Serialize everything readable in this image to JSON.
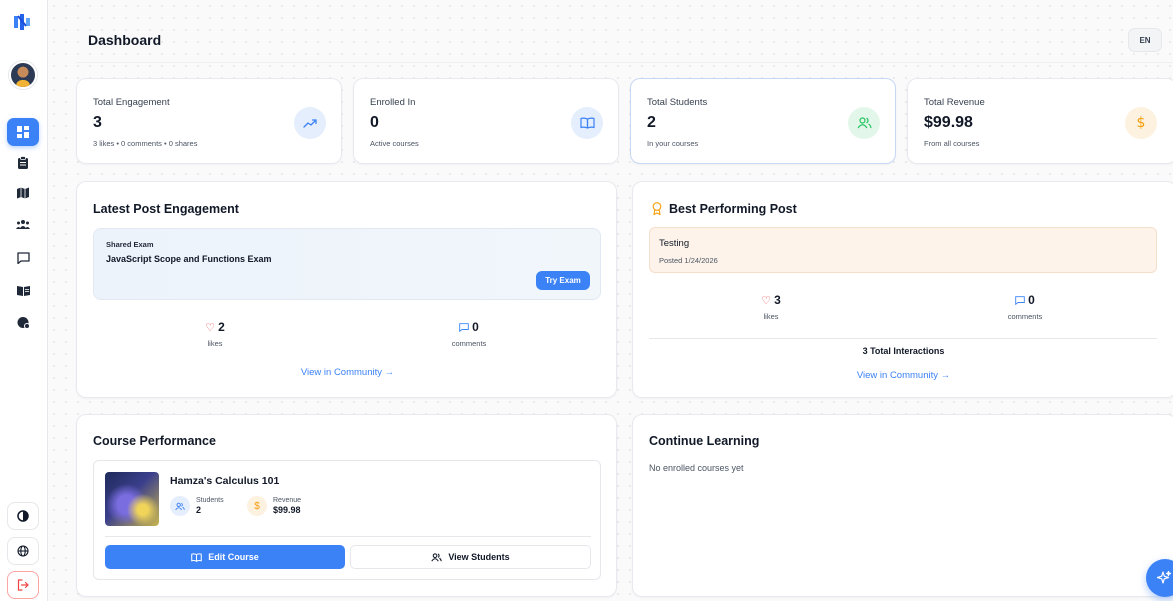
{
  "header": {
    "title": "Dashboard",
    "language": "EN"
  },
  "sidebar": {
    "items": [
      {
        "name": "dashboard",
        "icon": "dashboard-icon",
        "active": true
      },
      {
        "name": "clipboard",
        "icon": "clipboard-icon",
        "active": false
      },
      {
        "name": "map",
        "icon": "map-icon",
        "active": false
      },
      {
        "name": "community",
        "icon": "users-icon",
        "active": false
      },
      {
        "name": "messages",
        "icon": "message-icon",
        "active": false
      },
      {
        "name": "library",
        "icon": "book-open-icon",
        "active": false
      },
      {
        "name": "shield",
        "icon": "shield-icon",
        "active": false
      }
    ],
    "bottom": [
      "theme-icon",
      "globe-icon",
      "logout-icon"
    ]
  },
  "stats": [
    {
      "label": "Total Engagement",
      "value": "3",
      "sub": "3 likes • 0 comments • 0 shares",
      "icon": "trending-up-icon",
      "color": "#3b82f6"
    },
    {
      "label": "Enrolled In",
      "value": "0",
      "sub": "Active courses",
      "icon": "book-open-icon",
      "color": "#3b82f6"
    },
    {
      "label": "Total Students",
      "value": "2",
      "sub": "In your courses",
      "icon": "users-icon",
      "color": "#22c55e"
    },
    {
      "label": "Total Revenue",
      "value": "$99.98",
      "sub": "From all courses",
      "icon": "dollar-icon",
      "color": "#f59e0b"
    }
  ],
  "latest_post": {
    "title": "Latest Post Engagement",
    "tag": "Shared Exam",
    "exam_title": "JavaScript Scope and Functions Exam",
    "button": "Try Exam",
    "likes": "2",
    "likes_label": "likes",
    "comments": "0",
    "comments_label": "comments",
    "link": "View in Community →"
  },
  "best_post": {
    "title": "Best Performing Post",
    "post_title": "Testing",
    "posted": "Posted 1/24/2026",
    "likes": "3",
    "likes_label": "likes",
    "comments": "0",
    "comments_label": "comments",
    "total": "3 Total Interactions",
    "link": "View in Community →"
  },
  "course_performance": {
    "title": "Course Performance",
    "course_name": "Hamza's Calculus 101",
    "students_label": "Students",
    "students": "2",
    "revenue_label": "Revenue",
    "revenue": "$99.98",
    "edit_button": "Edit Course",
    "view_button": "View Students"
  },
  "continue_learning": {
    "title": "Continue Learning",
    "empty": "No enrolled courses yet"
  },
  "colors": {
    "accent": "#3b82f6",
    "like": "#ef4444",
    "award": "#f59e0b"
  }
}
